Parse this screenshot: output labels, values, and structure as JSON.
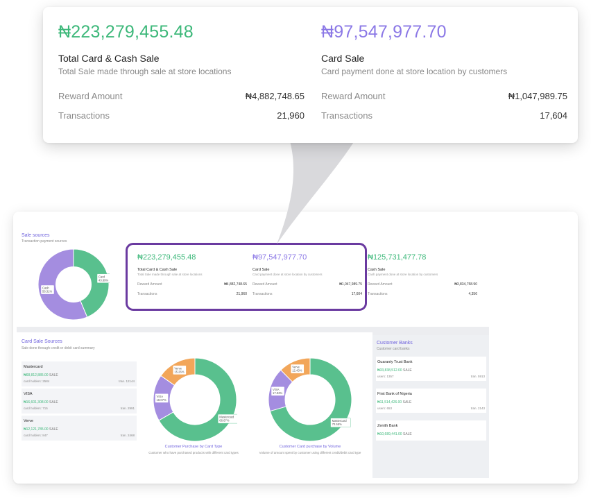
{
  "callout": {
    "total": {
      "amount": "₦223,279,455.48",
      "title": "Total Card & Cash Sale",
      "subtitle": "Total Sale made through sale at store locations",
      "reward_label": "Reward Amount",
      "reward_value": "₦4,882,748.65",
      "transactions_label": "Transactions",
      "transactions_value": "21,960"
    },
    "card": {
      "amount": "₦97,547,977.70",
      "title": "Card Sale",
      "subtitle": "Card payment done at store location by customers",
      "reward_label": "Reward Amount",
      "reward_value": "₦1,047,989.75",
      "transactions_label": "Transactions",
      "transactions_value": "17,604"
    }
  },
  "sale_sources": {
    "title": "Sale sources",
    "subtitle": "Transaction payment sources",
    "chart_data": {
      "type": "pie",
      "variant": "donut",
      "categories": [
        "Card",
        "Cash"
      ],
      "values": [
        43.69,
        56.31
      ],
      "labels": [
        "Card\n43.69%",
        "Cash\n56.31%"
      ],
      "colors": [
        "#59c08e",
        "#a48de0"
      ]
    }
  },
  "stats": [
    {
      "amount": "₦223,279,455.48",
      "title": "Total Card & Cash Sale",
      "subtitle": "Total Sale made through sale at store locations",
      "reward_label": "Reward Amount",
      "reward_value": "₦4,882,748.65",
      "transactions_label": "Transactions",
      "transactions_value": "21,960"
    },
    {
      "amount": "₦97,547,977.70",
      "title": "Card Sale",
      "subtitle": "Card payment done at store location by customers",
      "reward_label": "Reward Amount",
      "reward_value": "₦1,047,989.75",
      "transactions_label": "Transactions",
      "transactions_value": "17,604"
    },
    {
      "amount": "₦125,731,477.78",
      "title": "Cash Sale",
      "subtitle": "Cash payment done at store location by customers",
      "reward_label": "Reward Amount",
      "reward_value": "₦3,834,758.90",
      "transactions_label": "Transactions",
      "transactions_value": "4,356"
    }
  ],
  "card_sale_sources": {
    "title": "Card Sale Sources",
    "subtitle": "Sale done through credit or debit card summary",
    "items": [
      {
        "name": "Mastercard",
        "amount": "₦68,812,885.00",
        "amount_suffix": "SALE",
        "holders": "card holders: 2584",
        "tran": "tran. 12144"
      },
      {
        "name": "VISA",
        "amount": "₦16,601,308.00",
        "amount_suffix": "SALE",
        "holders": "card holders: 715",
        "tran": "tran. 2991"
      },
      {
        "name": "Verve",
        "amount": "₦12,121,785.00",
        "amount_suffix": "SALE",
        "holders": "card holders: 847",
        "tran": "tran. 2468"
      }
    ]
  },
  "charts": {
    "by_type": {
      "caption": "Customer Purchase by Card Type",
      "subtitle": "Customer who have purchased products with different card types",
      "chart_data": {
        "type": "pie",
        "variant": "donut",
        "categories": [
          "Mastercard",
          "VISA",
          "Verve"
        ],
        "values": [
          66.67,
          18.07,
          15.26
        ],
        "labels": [
          "Mastercard\n66.67%",
          "VISA\n18.07%",
          "Verve\n15.26%"
        ],
        "colors": [
          "#59c08e",
          "#a48de0",
          "#f2a65a"
        ]
      }
    },
    "by_volume": {
      "caption": "Customer Card purchase by Volume",
      "subtitle": "Volume of amount spent by customer using different credit/debit card type",
      "chart_data": {
        "type": "pie",
        "variant": "donut",
        "categories": [
          "Mastercard",
          "VISA",
          "Verve"
        ],
        "values": [
          70.55,
          17.02,
          12.43
        ],
        "labels": [
          "Mastercard\n70.55%",
          "VISA\n17.02%",
          "Verve\n12.43%"
        ],
        "colors": [
          "#59c08e",
          "#a48de0",
          "#f2a65a"
        ]
      }
    }
  },
  "banks": {
    "title": "Customer Banks",
    "subtitle": "Customer card banks",
    "items": [
      {
        "name": "Guaranty Trust Bank",
        "amount": "₦33,838,512.00",
        "amount_suffix": "SALE",
        "users": "users: 1357",
        "tran": "tran. 5913"
      },
      {
        "name": "First Bank of Nigeria",
        "amount": "₦11,514,426.00",
        "amount_suffix": "SALE",
        "users": "users: 653",
        "tran": "tran. 2143"
      },
      {
        "name": "Zenith Bank",
        "amount": "₦10,689,441.00",
        "amount_suffix": "SALE"
      }
    ]
  },
  "colors": {
    "green": "#3db87a",
    "purple": "#8b78e6",
    "highlight": "#6a3aa0",
    "accent_title": "#6c5fdc"
  }
}
